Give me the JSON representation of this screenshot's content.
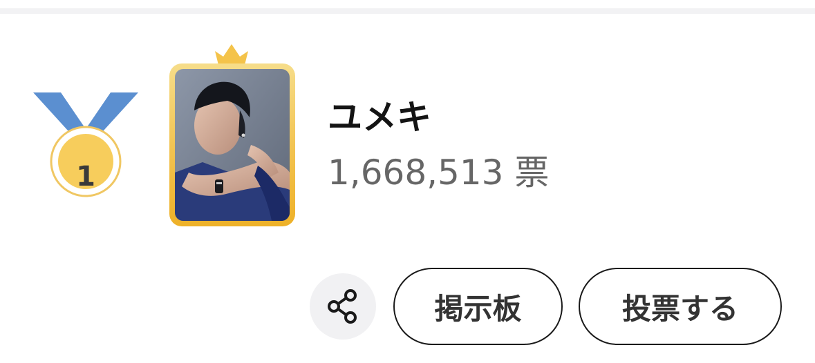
{
  "ranking": {
    "rank": "1",
    "member_name": "ユメキ",
    "vote_count": "1,668,513 票",
    "colors": {
      "medal_ribbon": "#5b8fd0",
      "medal_gold": "#f7cd5c",
      "frame_gold": "#f2c24e",
      "crown_gold": "#f4c34a",
      "name_text": "#141414",
      "count_text": "#666666"
    }
  },
  "actions": {
    "share_icon": "share-icon",
    "board_label": "掲示板",
    "vote_label": "投票する"
  }
}
